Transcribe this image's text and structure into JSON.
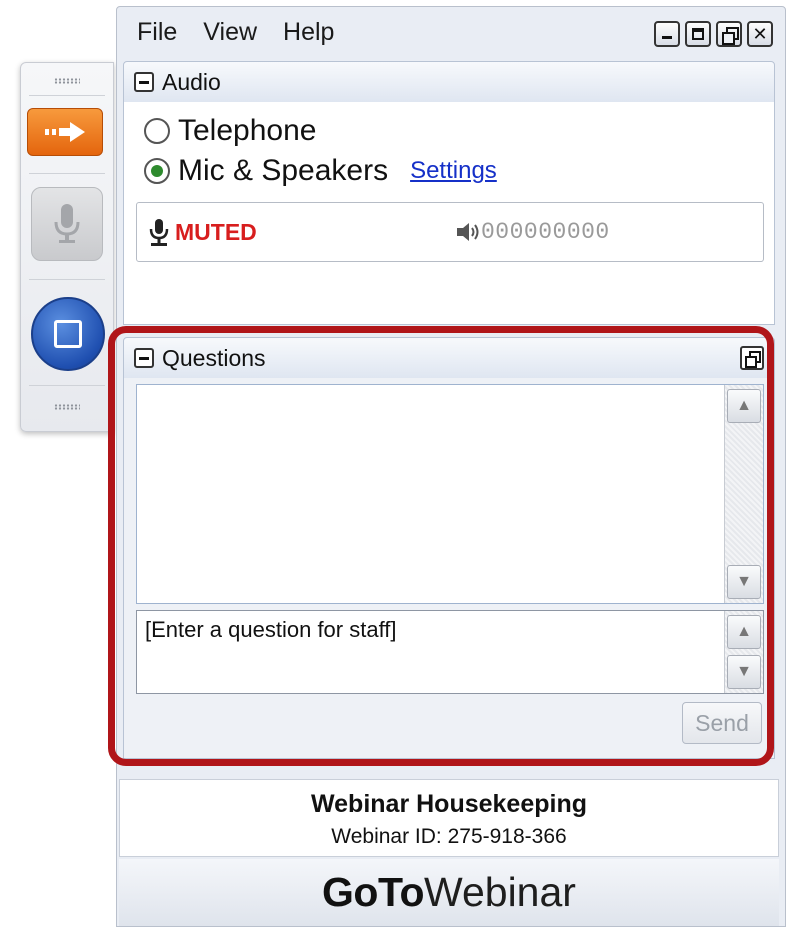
{
  "menu": [
    "File",
    "View",
    "Help"
  ],
  "window_controls": [
    "minimize",
    "maximize",
    "restore",
    "close"
  ],
  "audio": {
    "title": "Audio",
    "options": [
      {
        "label": "Telephone",
        "selected": false
      },
      {
        "label": "Mic & Speakers",
        "selected": true
      }
    ],
    "settings_link": "Settings",
    "status": "MUTED",
    "level_meter": "000000000"
  },
  "questions": {
    "title": "Questions",
    "input_placeholder": "[Enter a question for staff]",
    "send_label": "Send"
  },
  "footer": {
    "title": "Webinar Housekeeping",
    "webinar_id": "Webinar ID: 275-918-366"
  },
  "brand": {
    "bold": "GoTo",
    "light": "Webinar"
  },
  "colors": {
    "highlight": "#b01519",
    "muted": "#d81e1e",
    "link": "#1530c8",
    "arrow_button": "#f07f24",
    "screen_button": "#1f4fb0"
  },
  "icons": {
    "grab_tab_arrow": "arrow-right-icon",
    "mic": "microphone-icon",
    "screen": "screen-share-icon",
    "speaker": "speaker-icon"
  }
}
